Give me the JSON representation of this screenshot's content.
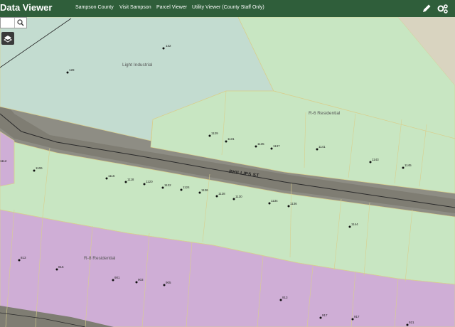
{
  "header": {
    "app_title": "Data Viewer",
    "nav_links": [
      "Sampson County",
      "Visit Sampson",
      "Parcel Viewer",
      "Utility Viewer (County Staff Only)"
    ]
  },
  "toolbar": {
    "search_value": "",
    "search_icon": "search-icon",
    "basemap_icon": "basemap-icon",
    "pencil_icon": "pencil-icon",
    "settings_icon": "gear-icon"
  },
  "colors": {
    "header_bg": "#2f5e3a",
    "industrial": "#c3dcd0",
    "residential_r6": "#c8e6c2",
    "residential_r8": "#cfaed6",
    "road": "#7f7d73"
  },
  "map": {
    "zones": [
      "Light Industrial",
      "R-6 Residential",
      "R-8 Residential"
    ],
    "street": "PHILLIPS ST",
    "parcels": [
      "132",
      "128",
      "1129",
      "1131",
      "1135",
      "1137",
      "1141",
      "1143",
      "1145",
      "1112",
      "1106",
      "1116",
      "1118",
      "1120",
      "1122",
      "1124",
      "1126",
      "1128",
      "1130",
      "1134",
      "1136",
      "1144",
      "813",
      "815",
      "901",
      "903",
      "905",
      "913",
      "917",
      "917",
      "921"
    ]
  }
}
